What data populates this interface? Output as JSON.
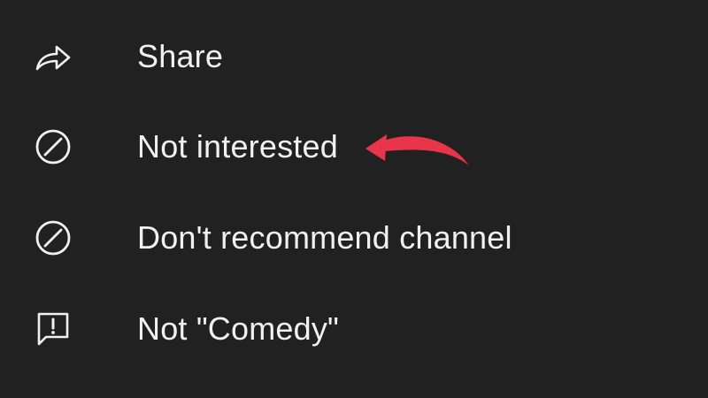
{
  "menu": {
    "items": [
      {
        "label": "Share",
        "icon": "share-icon"
      },
      {
        "label": "Not interested",
        "icon": "not-interested-icon"
      },
      {
        "label": "Don't recommend channel",
        "icon": "block-icon"
      },
      {
        "label": "Not \"Comedy\"",
        "icon": "report-icon"
      }
    ]
  },
  "colors": {
    "background": "#212121",
    "text": "#f1f1f1",
    "icon": "#f1f1f1",
    "annotation_arrow": "#e8354a"
  },
  "icons": {
    "annotation": "red-arrow-icon"
  }
}
